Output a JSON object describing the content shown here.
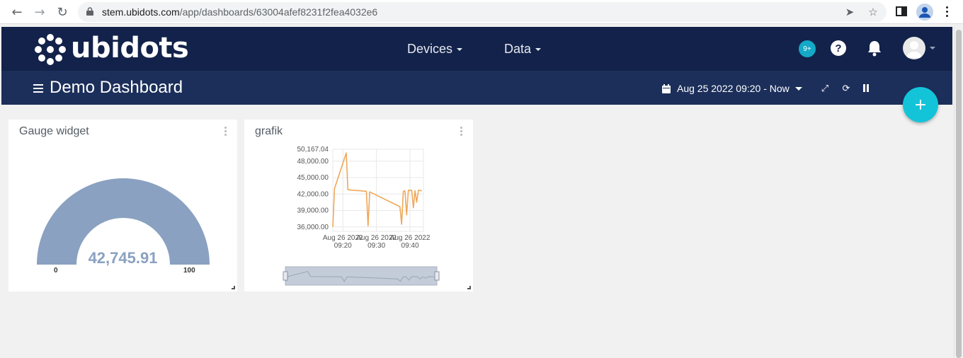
{
  "browser": {
    "url_host": "stem.ubidots.com",
    "url_path": "/app/dashboards/63004afef8231f2fea4032e6",
    "icons": [
      "back-icon",
      "forward-icon",
      "reload-icon",
      "lock-icon",
      "send-icon",
      "star-icon",
      "sidepanel-icon",
      "profile-icon",
      "kebab-menu-icon"
    ]
  },
  "header": {
    "logo_text": "ubidots",
    "menus": [
      {
        "label": "Devices"
      },
      {
        "label": "Data"
      }
    ],
    "notification_badge": "9+",
    "help_symbol": "?"
  },
  "dashboard": {
    "title": "Demo Dashboard",
    "date_range": "Aug 25 2022 09:20 - Now",
    "add_symbol": "+"
  },
  "widgets": {
    "gauge": {
      "title": "Gauge widget",
      "value": "42,745.91",
      "min": "0",
      "max": "100",
      "color": "#8aa1c1"
    },
    "chart": {
      "title": "grafik"
    }
  },
  "chart_data": {
    "type": "line",
    "title": "grafik",
    "color": "#f0a85a",
    "grid": true,
    "y_ticks": [
      "50,167.04",
      "48,000.00",
      "45,000.00",
      "42,000.00",
      "39,000.00",
      "36,000.00"
    ],
    "x_ticks": [
      {
        "date": "Aug 26 2022",
        "time": "09:20"
      },
      {
        "date": "Aug 26 2022",
        "time": "09:30"
      },
      {
        "date": "Aug 26 2022",
        "time": "09:40"
      }
    ],
    "ylim": [
      35200,
      50167.04
    ],
    "xlim": [
      "09:17",
      "09:44"
    ],
    "series": [
      {
        "points": [
          [
            "09:17:00",
            36000
          ],
          [
            "09:17:30",
            43000
          ],
          [
            "09:21:00",
            49500
          ],
          [
            "09:21:30",
            42800
          ],
          [
            "09:23:00",
            42700
          ],
          [
            "09:25:00",
            42600
          ],
          [
            "09:27:00",
            42500
          ],
          [
            "09:27:30",
            36200
          ],
          [
            "09:28:00",
            42400
          ],
          [
            "09:37:00",
            39700
          ],
          [
            "09:37:30",
            36500
          ],
          [
            "09:38:00",
            42500
          ],
          [
            "09:38:30",
            42600
          ],
          [
            "09:39:00",
            38200
          ],
          [
            "09:39:30",
            42700
          ],
          [
            "09:40:30",
            42700
          ],
          [
            "09:41:00",
            39500
          ],
          [
            "09:41:30",
            42600
          ],
          [
            "09:42:00",
            40500
          ],
          [
            "09:42:30",
            42700
          ],
          [
            "09:43:30",
            42600
          ]
        ]
      }
    ]
  }
}
